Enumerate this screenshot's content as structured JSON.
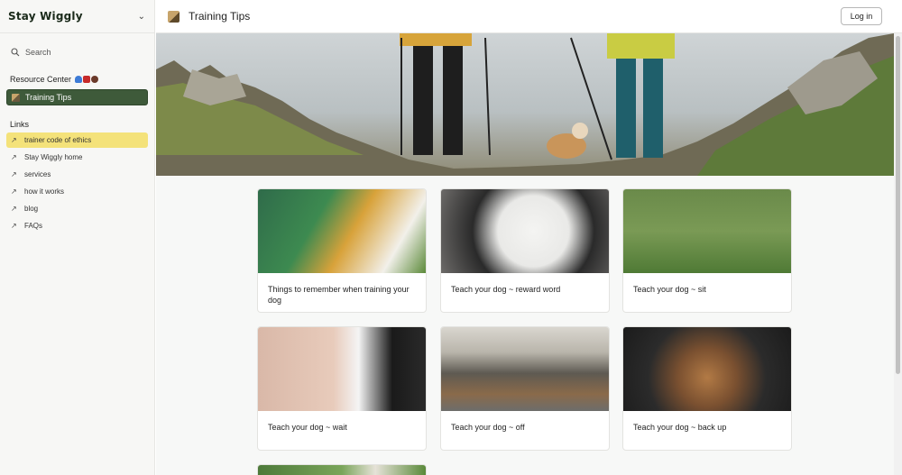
{
  "brand": {
    "name": "Stay Wiggly"
  },
  "sidebar": {
    "search_label": "Search",
    "resource_center_label": "Resource Center",
    "active_page": "Training Tips",
    "links_label": "Links",
    "links": [
      {
        "label": "trainer code of ethics",
        "highlighted": true
      },
      {
        "label": "Stay Wiggly home"
      },
      {
        "label": "services"
      },
      {
        "label": "how it works"
      },
      {
        "label": "blog"
      },
      {
        "label": "FAQs"
      }
    ]
  },
  "header": {
    "title": "Training Tips",
    "login_label": "Log in"
  },
  "cards": [
    {
      "title": "Things to remember when training your dog"
    },
    {
      "title": "Teach your dog ~ reward word"
    },
    {
      "title": "Teach your dog ~ sit"
    },
    {
      "title": "Teach your dog ~ wait"
    },
    {
      "title": "Teach your dog ~ off"
    },
    {
      "title": "Teach your dog ~ back up"
    }
  ],
  "colors": {
    "active_nav": "#3e5a3a",
    "highlight": "#f4e27a"
  }
}
